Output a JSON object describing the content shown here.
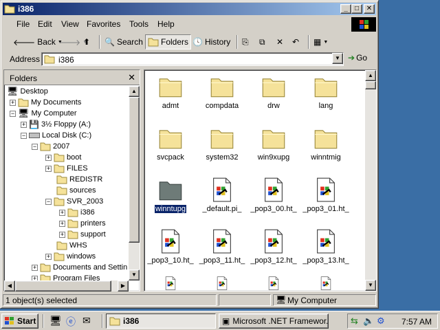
{
  "window": {
    "title": "i386",
    "menu": [
      "File",
      "Edit",
      "View",
      "Favorites",
      "Tools",
      "Help"
    ],
    "toolbar": {
      "back": "Back",
      "search": "Search",
      "folders": "Folders",
      "history": "History"
    },
    "address": {
      "label": "Address",
      "value": "i386",
      "go": "Go"
    }
  },
  "folders_pane": {
    "title": "Folders",
    "tree": [
      {
        "label": "Desktop",
        "icon": "desktop-icon"
      },
      {
        "label": "My Documents",
        "icon": "folder-icon"
      },
      {
        "label": "My Computer",
        "icon": "computer-icon"
      },
      {
        "label": "3½ Floppy (A:)",
        "icon": "floppy-icon"
      },
      {
        "label": "Local Disk (C:)",
        "icon": "drive-icon"
      },
      {
        "label": "2007",
        "icon": "folder-icon"
      },
      {
        "label": "boot",
        "icon": "folder-icon"
      },
      {
        "label": "FILES",
        "icon": "folder-icon"
      },
      {
        "label": "REDISTR",
        "icon": "folder-icon"
      },
      {
        "label": "sources",
        "icon": "folder-icon"
      },
      {
        "label": "SVR_2003",
        "icon": "folder-icon"
      },
      {
        "label": "i386",
        "icon": "folder-open-icon"
      },
      {
        "label": "printers",
        "icon": "folder-icon"
      },
      {
        "label": "support",
        "icon": "folder-icon"
      },
      {
        "label": "WHS",
        "icon": "folder-icon"
      },
      {
        "label": "windows",
        "icon": "folder-icon"
      },
      {
        "label": "Documents and Settin",
        "icon": "folder-icon"
      },
      {
        "label": "Program Files",
        "icon": "folder-icon"
      }
    ]
  },
  "files": [
    {
      "label": "admt",
      "type": "folder"
    },
    {
      "label": "compdata",
      "type": "folder"
    },
    {
      "label": "drw",
      "type": "folder"
    },
    {
      "label": "lang",
      "type": "folder"
    },
    {
      "label": "svcpack",
      "type": "folder"
    },
    {
      "label": "system32",
      "type": "folder"
    },
    {
      "label": "win9xupg",
      "type": "folder"
    },
    {
      "label": "winntmig",
      "type": "folder"
    },
    {
      "label": "winntupg",
      "type": "folder-selected"
    },
    {
      "label": "_default.pi_",
      "type": "file"
    },
    {
      "label": "_pop3_00.ht_",
      "type": "file"
    },
    {
      "label": "_pop3_01.ht_",
      "type": "file"
    },
    {
      "label": "_pop3_10.ht_",
      "type": "file"
    },
    {
      "label": "_pop3_11.ht_",
      "type": "file"
    },
    {
      "label": "_pop3_12.ht_",
      "type": "file"
    },
    {
      "label": "_pop3_13.ht_",
      "type": "file"
    }
  ],
  "statusbar": {
    "selection": "1 object(s) selected",
    "location": "My Computer"
  },
  "taskbar": {
    "start": "Start",
    "tasks": [
      "i386",
      "Microsoft .NET Framewor..."
    ],
    "clock": "7:57 AM"
  },
  "colors": {
    "title_start": "#0a246a",
    "title_end": "#a6caf0",
    "desktop": "#3a6ea5",
    "folder": "#f5e29a",
    "selection": "#0a246a"
  }
}
